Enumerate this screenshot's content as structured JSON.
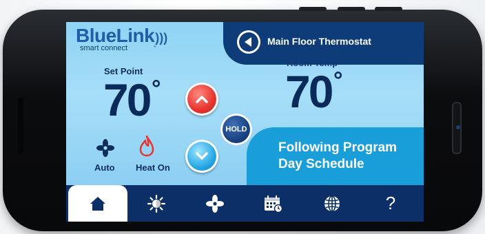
{
  "logo": {
    "name": "BlueLink",
    "tagline": "smart connect",
    "tm": "™"
  },
  "header": {
    "title": "Main Floor Thermostat"
  },
  "set_point": {
    "label": "Set Point",
    "value": "70",
    "unit": "°"
  },
  "room_temp": {
    "label": "Room Temp",
    "value": "70",
    "unit": "°"
  },
  "controls": {
    "hold_label": "HOLD"
  },
  "fan": {
    "label": "Auto"
  },
  "mode": {
    "label": "Heat On"
  },
  "program": {
    "line1": "Following Program",
    "line2": "Day Schedule"
  },
  "tabs": [
    {
      "icon": "home-icon",
      "active": true
    },
    {
      "icon": "sun-icon",
      "active": false
    },
    {
      "icon": "fan-icon",
      "active": false
    },
    {
      "icon": "calendar-icon",
      "active": false
    },
    {
      "icon": "globe-icon",
      "active": false
    },
    {
      "icon": "help-icon",
      "label": "?",
      "active": false
    }
  ],
  "colors": {
    "brand": "#1f5ca9",
    "navy": "#0d3c78",
    "screen_bg": "#a6def8",
    "heat": "#e8332e",
    "cool": "#27a8e6",
    "accent": "#1a9ed9"
  }
}
